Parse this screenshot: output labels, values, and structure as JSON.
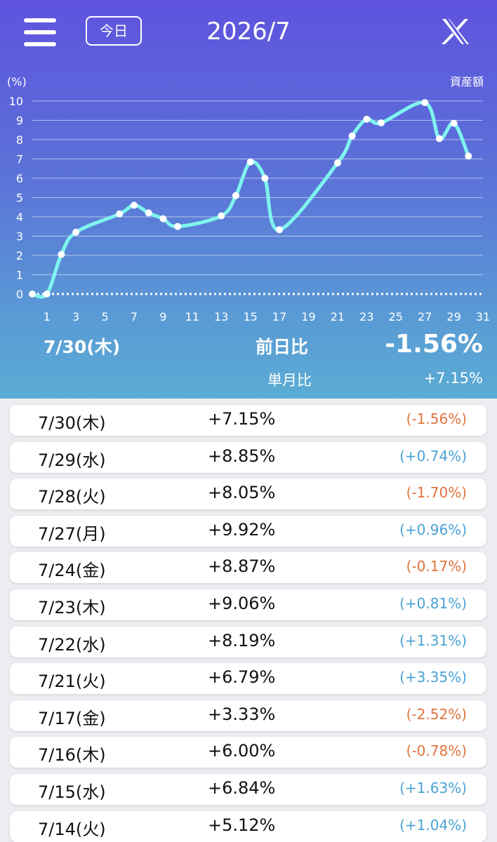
{
  "header": {
    "today_label": "今日",
    "month_title": "2026/7",
    "menu_icon": "hamburger-menu-icon",
    "share_icon": "x-logo-icon"
  },
  "chart_labels": {
    "y_unit": "(%)",
    "right_label": "資産額"
  },
  "chart_data": {
    "type": "line",
    "title": "",
    "xlabel": "",
    "ylabel": "(%)",
    "xlim": [
      0,
      31
    ],
    "ylim": [
      0,
      10
    ],
    "y_ticks": [
      0,
      1,
      2,
      3,
      4,
      5,
      6,
      7,
      8,
      9,
      10
    ],
    "x_ticks": [
      1,
      3,
      5,
      7,
      9,
      11,
      13,
      15,
      17,
      19,
      21,
      23,
      25,
      27,
      29,
      31
    ],
    "grid": true,
    "line_color": "#7ff5ee",
    "series": [
      {
        "x": [
          0,
          1,
          2,
          3,
          6,
          7,
          8,
          9,
          10,
          13,
          14,
          15,
          16,
          17,
          21,
          22,
          23,
          24,
          27,
          28,
          29,
          30
        ],
        "values": [
          0,
          0,
          2.05,
          3.2,
          4.15,
          4.6,
          4.2,
          3.9,
          3.5,
          4.05,
          5.1,
          6.84,
          6.0,
          3.33,
          6.79,
          8.19,
          9.06,
          8.87,
          9.92,
          8.05,
          8.85,
          7.15
        ]
      }
    ]
  },
  "summary": {
    "date": "7/30(木)",
    "prev_day_label": "前日比",
    "prev_day_value": "-1.56%",
    "month_label": "単月比",
    "month_value": "+7.15%"
  },
  "colors": {
    "negative": "#e0733c",
    "positive": "#4aa2d4"
  },
  "rows": [
    {
      "date": "7/30(木)",
      "value": "+7.15%",
      "diff": "(-1.56%)",
      "sign": "neg"
    },
    {
      "date": "7/29(水)",
      "value": "+8.85%",
      "diff": "(+0.74%)",
      "sign": "pos"
    },
    {
      "date": "7/28(火)",
      "value": "+8.05%",
      "diff": "(-1.70%)",
      "sign": "neg"
    },
    {
      "date": "7/27(月)",
      "value": "+9.92%",
      "diff": "(+0.96%)",
      "sign": "pos"
    },
    {
      "date": "7/24(金)",
      "value": "+8.87%",
      "diff": "(-0.17%)",
      "sign": "neg"
    },
    {
      "date": "7/23(木)",
      "value": "+9.06%",
      "diff": "(+0.81%)",
      "sign": "pos"
    },
    {
      "date": "7/22(水)",
      "value": "+8.19%",
      "diff": "(+1.31%)",
      "sign": "pos"
    },
    {
      "date": "7/21(火)",
      "value": "+6.79%",
      "diff": "(+3.35%)",
      "sign": "pos"
    },
    {
      "date": "7/17(金)",
      "value": "+3.33%",
      "diff": "(-2.52%)",
      "sign": "neg"
    },
    {
      "date": "7/16(木)",
      "value": "+6.00%",
      "diff": "(-0.78%)",
      "sign": "neg"
    },
    {
      "date": "7/15(水)",
      "value": "+6.84%",
      "diff": "(+1.63%)",
      "sign": "pos"
    },
    {
      "date": "7/14(火)",
      "value": "+5.12%",
      "diff": "(+1.04%)",
      "sign": "pos"
    }
  ]
}
